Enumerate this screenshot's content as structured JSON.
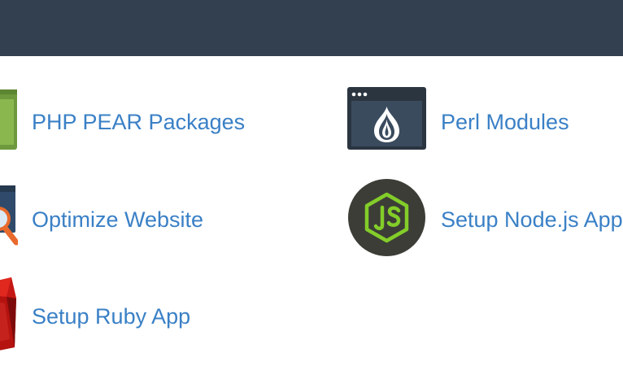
{
  "header": {
    "background_color": "#33404f"
  },
  "colors": {
    "link_text": "#3a80c6"
  },
  "tools": [
    {
      "label": "PHP PEAR Packages",
      "icon": "php-pear-icon"
    },
    {
      "label": "Perl Modules",
      "icon": "perl-onion-icon"
    },
    {
      "label": "Optimize Website",
      "icon": "optimize-magnifier-icon"
    },
    {
      "label": "Setup Node.js App",
      "icon": "nodejs-icon"
    },
    {
      "label": "Setup Ruby App",
      "icon": "ruby-gem-icon"
    }
  ]
}
